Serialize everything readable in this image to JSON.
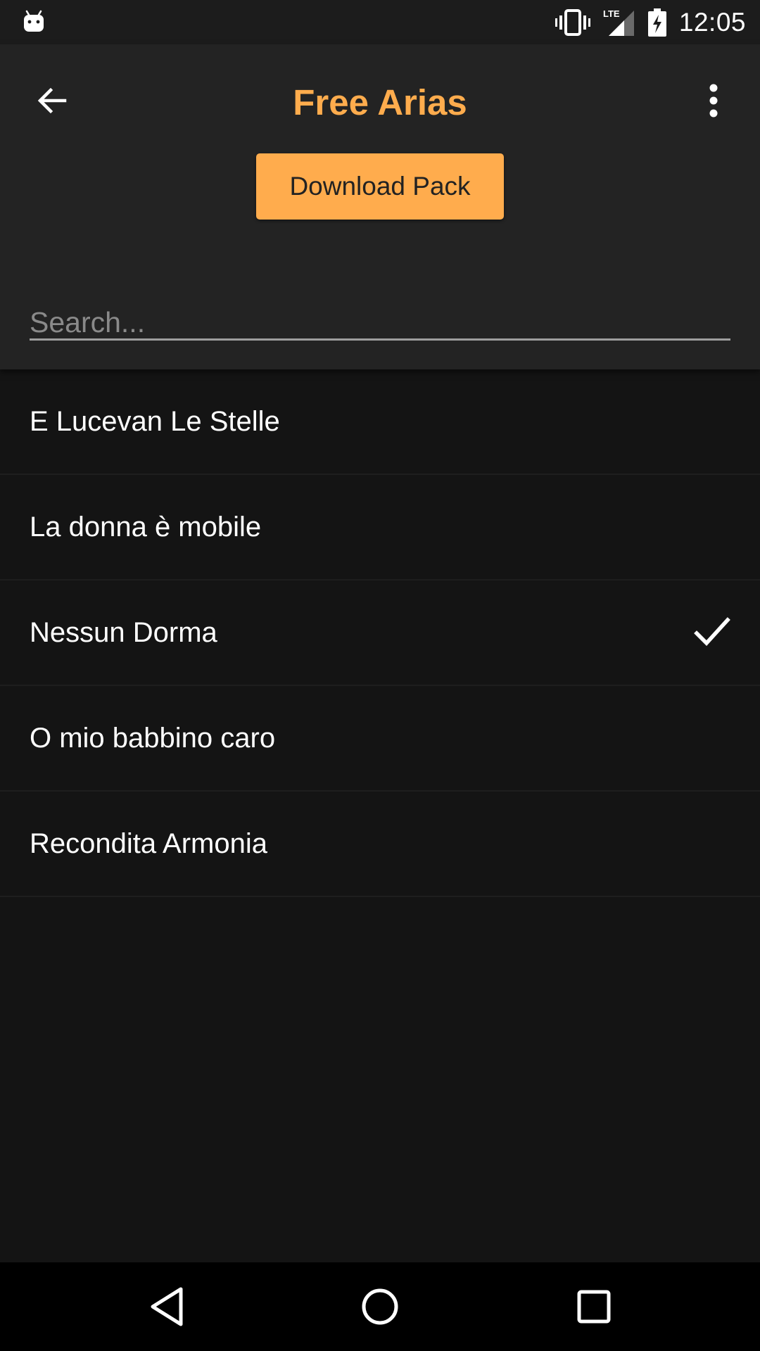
{
  "status_bar": {
    "time": "12:05",
    "network": "LTE"
  },
  "header": {
    "title": "Free Arias",
    "download_label": "Download Pack"
  },
  "search": {
    "placeholder": "Search...",
    "value": ""
  },
  "arias": [
    {
      "title": "E Lucevan Le Stelle",
      "checked": false
    },
    {
      "title": "La donna è mobile",
      "checked": false
    },
    {
      "title": "Nessun Dorma",
      "checked": true
    },
    {
      "title": "O mio babbino caro",
      "checked": false
    },
    {
      "title": "Recondita Armonia",
      "checked": false
    }
  ],
  "colors": {
    "accent": "#ffac4d",
    "header_bg": "#232323",
    "list_bg": "#141414"
  }
}
